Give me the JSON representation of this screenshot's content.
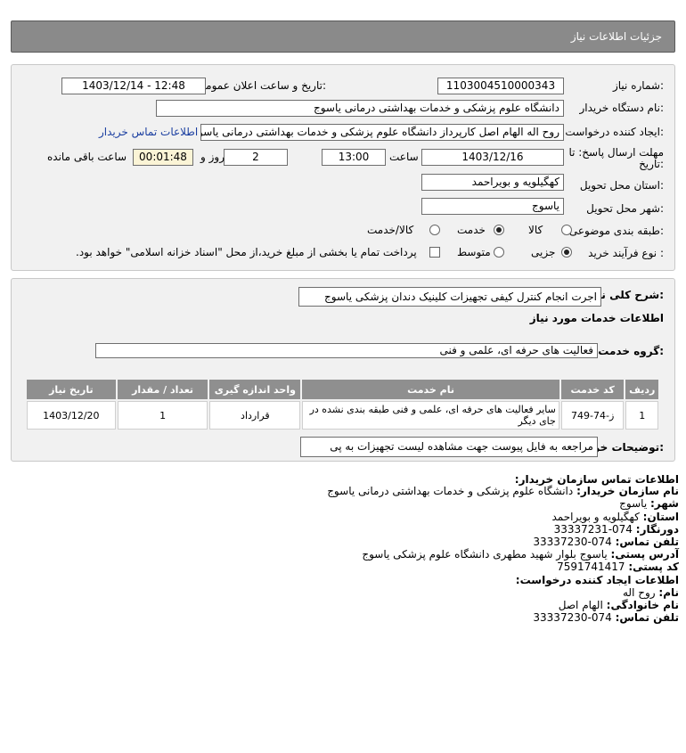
{
  "header": {
    "title": "جزئیات اطلاعات نیاز"
  },
  "form": {
    "need_number_label": "شماره نیاز:",
    "need_number": "1103004510000343",
    "announce_label": "تاریخ و ساعت اعلان عمومی:",
    "announce_value": "1403/12/14 - 12:48",
    "buyer_label": "نام دستگاه خریدار:",
    "buyer_value": "دانشگاه علوم پزشکی و خدمات بهداشتی  درمانی یاسوج",
    "creator_label": "ایجاد کننده درخواست:",
    "creator_value": "روح اله الهام اصل کارپرداز دانشگاه علوم پزشکی و خدمات بهداشتی  درمانی یاسوج",
    "contact_link": "اطلاعات تماس خریدار",
    "deadline_label_1": "مهلت ارسال پاسخ: تا",
    "deadline_label_2": "تاریخ:",
    "deadline_date": "1403/12/16",
    "time_label": "ساعت",
    "deadline_time": "13:00",
    "days_value": "2",
    "days_label": "روز و",
    "remaining_time": "00:01:48",
    "remaining_label": "ساعت باقی مانده",
    "province_label": "استان محل تحویل:",
    "province_value": "کهگیلویه و بویراحمد",
    "city_label": "شهر محل تحویل:",
    "city_value": "یاسوج",
    "category_label": "طبقه بندی موضوعی:",
    "category_options": [
      "کالا",
      "خدمت",
      "کالا/خدمت"
    ],
    "process_label": "نوع فرآیند خرید :",
    "process_options": [
      "جزیی",
      "متوسط"
    ],
    "payment_text": "پرداخت تمام یا بخشی از مبلغ خرید،از محل \"اسناد خزانه اسلامی\" خواهد بود."
  },
  "details": {
    "summary_label": "شرح کلی نیاز:",
    "summary_value": "اجرت انجام کنترل کیفی تجهیزات کلینیک دندان پزشکی یاسوج",
    "services_heading": "اطلاعات خدمات مورد نیاز",
    "group_label": "گروه خدمت:",
    "group_value": "فعالیت های حرفه ای، علمی و فنی",
    "table": {
      "headers": [
        "ردیف",
        "کد خدمت",
        "نام خدمت",
        "واحد اندازه گیری",
        "تعداد / مقدار",
        "تاریخ نیاز"
      ],
      "rows": [
        [
          "1",
          "ز-74-749",
          "سایر فعالیت های حرفه ای، علمی و فنی طبقه بندی نشده در جای دیگر",
          "قرارداد",
          "1",
          "1403/12/20"
        ]
      ]
    },
    "notes_label": "توضیحات خریدار:",
    "notes_value": "مراجعه به فایل پیوست جهت مشاهده لیست تجهیزات به پی"
  },
  "contact": {
    "heading": "اطلاعات تماس سازمان خریدار:",
    "org_label": "نام سازمان خریدار:",
    "org_value": "دانشگاه علوم پزشکی و خدمات بهداشتی درمانی یاسوج",
    "city_label": "شهر:",
    "city_value": "یاسوج",
    "province_label": "استان:",
    "province_value": "کهگیلویه و بویراحمد",
    "fax_label": "دورنگار:",
    "fax_value": "074-33337231",
    "phone_label": "تلفن تماس:",
    "phone_value": "074-33337230",
    "address_label": "آدرس پستی:",
    "address_value": "یاسوج بلوار شهید مطهری دانشگاه علوم پزشکی یاسوج",
    "postal_label": "کد پستی:",
    "postal_value": "7591741417",
    "creator_heading": "اطلاعات ایجاد کننده درخواست:",
    "name_label": "نام:",
    "name_value": "روح اله",
    "family_label": "نام خانوادگی:",
    "family_value": "الهام اصل",
    "creator_phone_label": "تلفن تماس:",
    "creator_phone_value": "074-33337230"
  }
}
